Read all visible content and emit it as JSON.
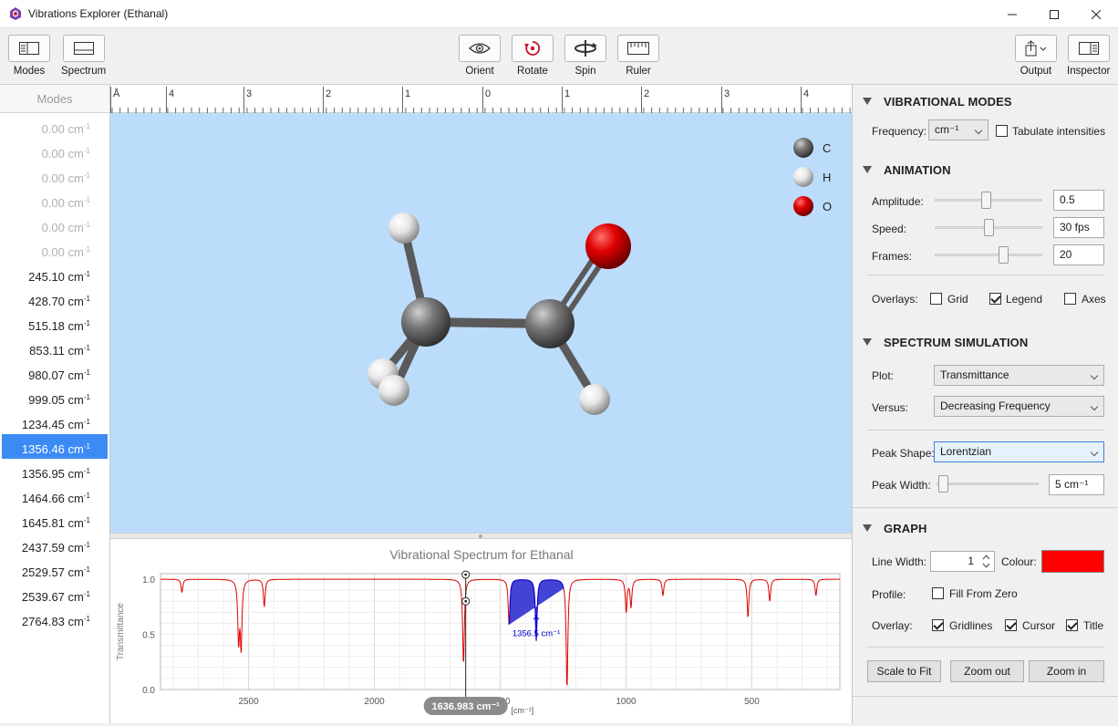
{
  "window": {
    "title": "Vibrations Explorer (Ethanal)"
  },
  "toolbar": {
    "modes": "Modes",
    "spectrum": "Spectrum",
    "orient": "Orient",
    "rotate": "Rotate",
    "spin": "Spin",
    "ruler": "Ruler",
    "output": "Output",
    "inspector": "Inspector"
  },
  "modes": {
    "header": "Modes",
    "unit": "cm",
    "unit_exp": "-1",
    "items": [
      {
        "value": "0.00",
        "disabled": true
      },
      {
        "value": "0.00",
        "disabled": true
      },
      {
        "value": "0.00",
        "disabled": true
      },
      {
        "value": "0.00",
        "disabled": true
      },
      {
        "value": "0.00",
        "disabled": true
      },
      {
        "value": "0.00",
        "disabled": true
      },
      {
        "value": "245.10"
      },
      {
        "value": "428.70"
      },
      {
        "value": "515.18"
      },
      {
        "value": "853.11"
      },
      {
        "value": "980.07"
      },
      {
        "value": "999.05"
      },
      {
        "value": "1234.45"
      },
      {
        "value": "1356.46",
        "selected": true
      },
      {
        "value": "1356.95"
      },
      {
        "value": "1464.66"
      },
      {
        "value": "1645.81"
      },
      {
        "value": "2437.59"
      },
      {
        "value": "2529.57"
      },
      {
        "value": "2539.67"
      },
      {
        "value": "2764.83"
      }
    ]
  },
  "ruler": {
    "unit": "Å",
    "labels": [
      "4",
      "3",
      "2",
      "1",
      "0",
      "1",
      "2",
      "3",
      "4"
    ]
  },
  "legend": [
    {
      "symbol": "C",
      "color": "#6e6e6e"
    },
    {
      "symbol": "H",
      "color": "#e8e8e8"
    },
    {
      "symbol": "O",
      "color": "#d40000"
    }
  ],
  "spectrum": {
    "title": "Vibrational Spectrum for Ethanal",
    "ylabel": "Transmittance",
    "xunit": "[cm⁻¹]",
    "cursor_label": "1636.983 cm⁻¹",
    "peak_label": "1356.5 cm⁻¹",
    "xticks": [
      "2500",
      "2000",
      "1500",
      "1000",
      "500"
    ],
    "yticks": [
      "1.0",
      "0.5",
      "0.0"
    ]
  },
  "chart_data": {
    "type": "line",
    "title": "Vibrational Spectrum for Ethanal",
    "ylabel": "Transmittance",
    "xlabel": "[cm⁻¹]",
    "xlim": [
      2850,
      150
    ],
    "ylim": [
      0,
      1.05
    ],
    "peaks": [
      {
        "x": 2764.83,
        "depth": 0.12
      },
      {
        "x": 2539.67,
        "depth": 0.55
      },
      {
        "x": 2529.57,
        "depth": 0.6
      },
      {
        "x": 2437.59,
        "depth": 0.25
      },
      {
        "x": 1645.81,
        "depth": 0.78
      },
      {
        "x": 1464.66,
        "depth": 0.42
      },
      {
        "x": 1356.46,
        "depth": 0.28
      },
      {
        "x": 1356.95,
        "depth": 0.28
      },
      {
        "x": 1234.45,
        "depth": 1.0
      },
      {
        "x": 999.05,
        "depth": 0.3
      },
      {
        "x": 980.07,
        "depth": 0.25
      },
      {
        "x": 853.11,
        "depth": 0.15
      },
      {
        "x": 515.18,
        "depth": 0.35
      },
      {
        "x": 428.7,
        "depth": 0.2
      },
      {
        "x": 245.1,
        "depth": 0.15
      }
    ],
    "cursor_x": 1636.983,
    "highlight_x": 1356.5
  },
  "inspector": {
    "vib": {
      "title": "VIBRATIONAL MODES",
      "freq_label": "Frequency:",
      "freq_value": "cm⁻¹",
      "tabulate": "Tabulate intensities"
    },
    "anim": {
      "title": "ANIMATION",
      "amplitude": "Amplitude:",
      "amplitude_value": "0.5",
      "amplitude_level": 0.48,
      "speed": "Speed:",
      "speed_value": "30 fps",
      "speed_level": 0.5,
      "frames": "Frames:",
      "frames_value": "20",
      "frames_level": 0.65,
      "overlays": "Overlays:",
      "grid": "Grid",
      "legend": "Legend",
      "axes": "Axes"
    },
    "sim": {
      "title": "SPECTRUM SIMULATION",
      "plot": "Plot:",
      "plot_value": "Transmittance",
      "versus": "Versus:",
      "versus_value": "Decreasing Frequency",
      "shape": "Peak Shape:",
      "shape_value": "Lorentzian",
      "width": "Peak Width:",
      "width_value": "5 cm⁻¹",
      "width_level": 0.02
    },
    "graph": {
      "title": "GRAPH",
      "line_width": "Line Width:",
      "line_width_value": "1",
      "colour": "Colour:",
      "colour_value": "#ff0000",
      "profile": "Profile:",
      "fill": "Fill From Zero",
      "overlay": "Overlay:",
      "gridlines": "Gridlines",
      "cursor": "Cursor",
      "title_opt": "Title",
      "scale": "Scale to Fit",
      "zoom_out": "Zoom out",
      "zoom_in": "Zoom in"
    }
  }
}
